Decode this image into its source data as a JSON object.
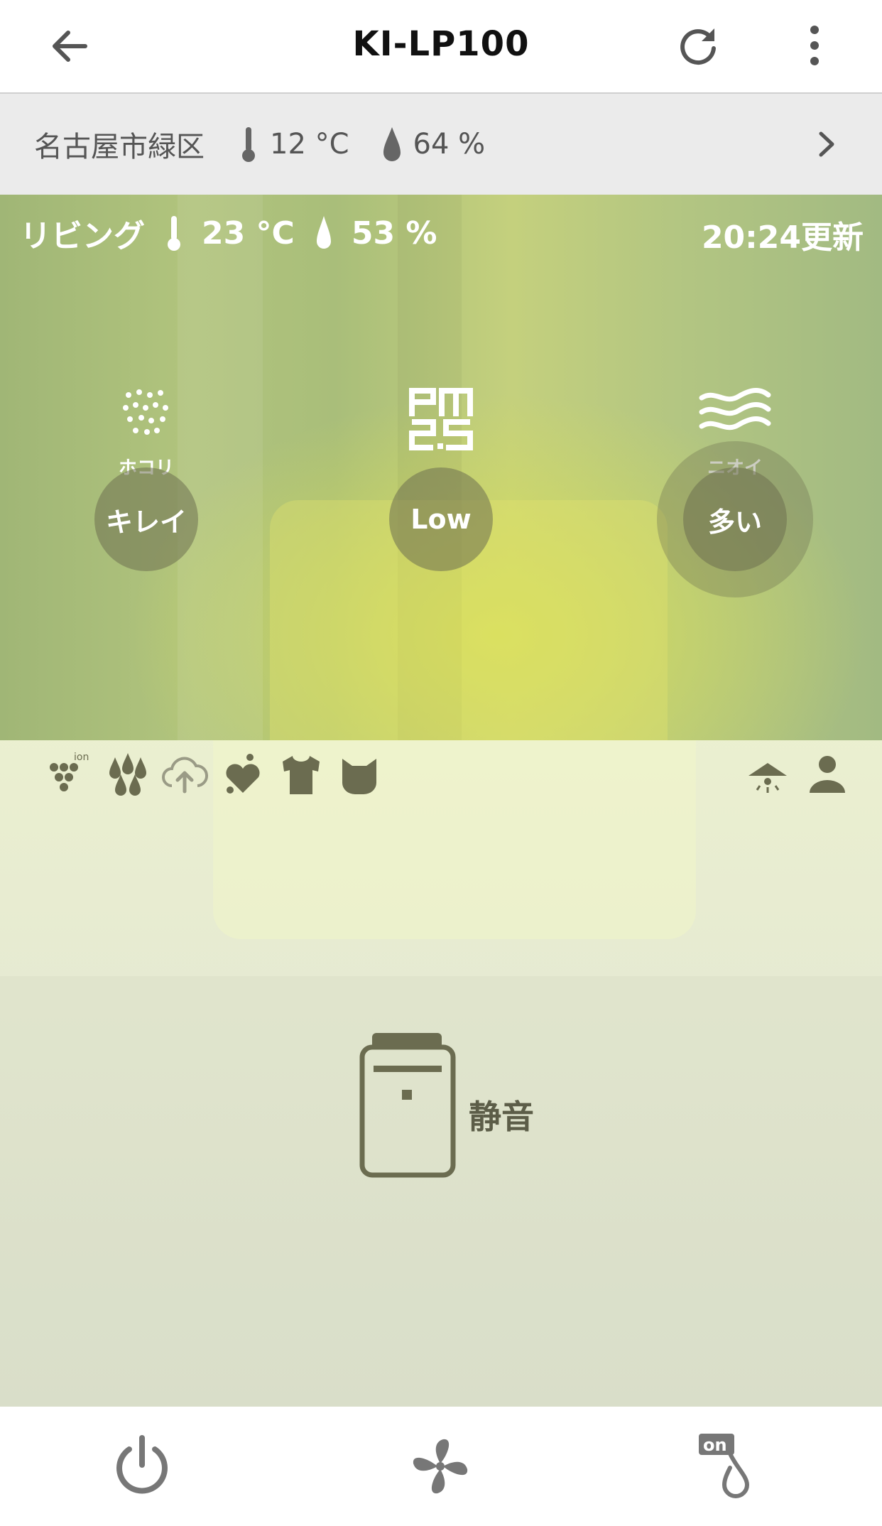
{
  "header": {
    "title": "KI-LP100",
    "back_icon": "arrow-left-icon",
    "refresh_icon": "refresh-icon",
    "more_icon": "more-vertical-icon"
  },
  "outdoor": {
    "location": "名古屋市緑区",
    "temperature": "12 °C",
    "humidity": "64 %"
  },
  "room": {
    "name": "リビング",
    "temperature": "23 °C",
    "humidity": "53 %",
    "updated": "20:24更新"
  },
  "sensors": [
    {
      "label": "ホコリ",
      "status": "キレイ",
      "icon": "dust-icon"
    },
    {
      "label": "",
      "status": "Low",
      "icon": "pm25-icon"
    },
    {
      "label": "ニオイ",
      "status": "多い",
      "icon": "odor-icon"
    }
  ],
  "device": {
    "mode_label": "静音",
    "icon": "air-purifier-icon"
  },
  "mode_icons": [
    "ion-icon",
    "humidify-drops-icon",
    "cloud-upload-icon",
    "heart-icon",
    "shirt-icon",
    "cat-icon",
    "ceiling-light-icon",
    "person-icon"
  ],
  "bottom_bar": [
    "power-icon",
    "fan-icon",
    "humidify-on-icon"
  ],
  "colors": {
    "header_bg": "#ffffff",
    "weather_bar_bg": "#ebebeb",
    "scene_green": "#a9be7a",
    "accent_olive": "#6b6c50",
    "bottom_icon": "#777777"
  }
}
